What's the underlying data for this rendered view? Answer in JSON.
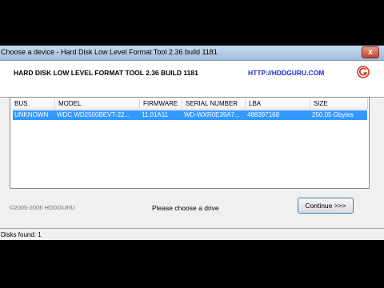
{
  "window": {
    "title": "Choose a device - Hard Disk Low Level Format Tool 2.36 build 1181",
    "close_label": "x"
  },
  "header": {
    "product_title": "HARD DISK LOW LEVEL FORMAT TOOL 2.36 BUILD 1181",
    "site_link": "HTTP://HDDGURU.COM",
    "logo_icon": "hddguru-logo-icon"
  },
  "device_list": {
    "columns": [
      {
        "label": "BUS"
      },
      {
        "label": "MODEL"
      },
      {
        "label": "FIRMWARE"
      },
      {
        "label": "SERIAL NUMBER"
      },
      {
        "label": "LBA"
      },
      {
        "label": "SIZE"
      }
    ],
    "rows": [
      {
        "selected": true,
        "cells": [
          "UNKNOWN",
          "WDC WD2500BEVT-22...",
          "11.01A11",
          "WD-WXR0E39A7...",
          "488397168",
          "250.05 Gbytes"
        ]
      }
    ]
  },
  "footer": {
    "copyright": "©2005-2006 HDDGURU",
    "prompt": "Please choose a drive",
    "continue_label": "Continue >>>"
  },
  "status": {
    "text": "Disks found: 1"
  },
  "colors": {
    "selection": "#3399ff",
    "link": "#1d2fd6",
    "logo_red": "#d9372b"
  }
}
